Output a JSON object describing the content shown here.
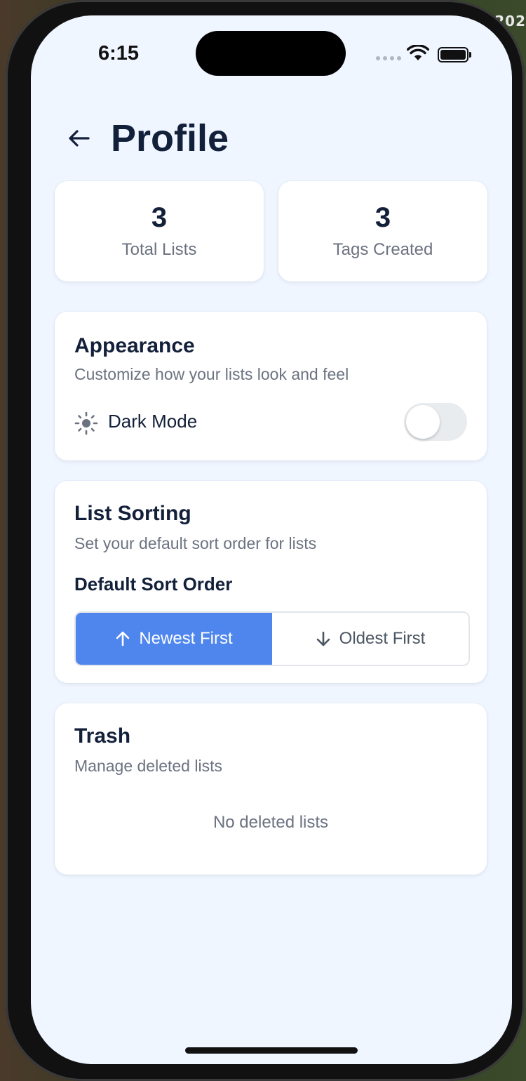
{
  "background": {
    "corner_text": "202"
  },
  "status_bar": {
    "time": "6:15"
  },
  "header": {
    "title": "Profile"
  },
  "stats": [
    {
      "value": "3",
      "label": "Total Lists"
    },
    {
      "value": "3",
      "label": "Tags Created"
    }
  ],
  "appearance": {
    "title": "Appearance",
    "subtitle": "Customize how your lists look and feel",
    "dark_mode_label": "Dark Mode",
    "dark_mode_on": false
  },
  "sorting": {
    "title": "List Sorting",
    "subtitle": "Set your default sort order for lists",
    "field_label": "Default Sort Order",
    "options": [
      "Newest First",
      "Oldest First"
    ],
    "selected": "Newest First"
  },
  "trash": {
    "title": "Trash",
    "subtitle": "Manage deleted lists",
    "empty_text": "No deleted lists"
  },
  "colors": {
    "accent": "#4f86ee",
    "screen_bg": "#f0f6ff",
    "text_primary": "#13203a",
    "text_secondary": "#6b7280"
  }
}
